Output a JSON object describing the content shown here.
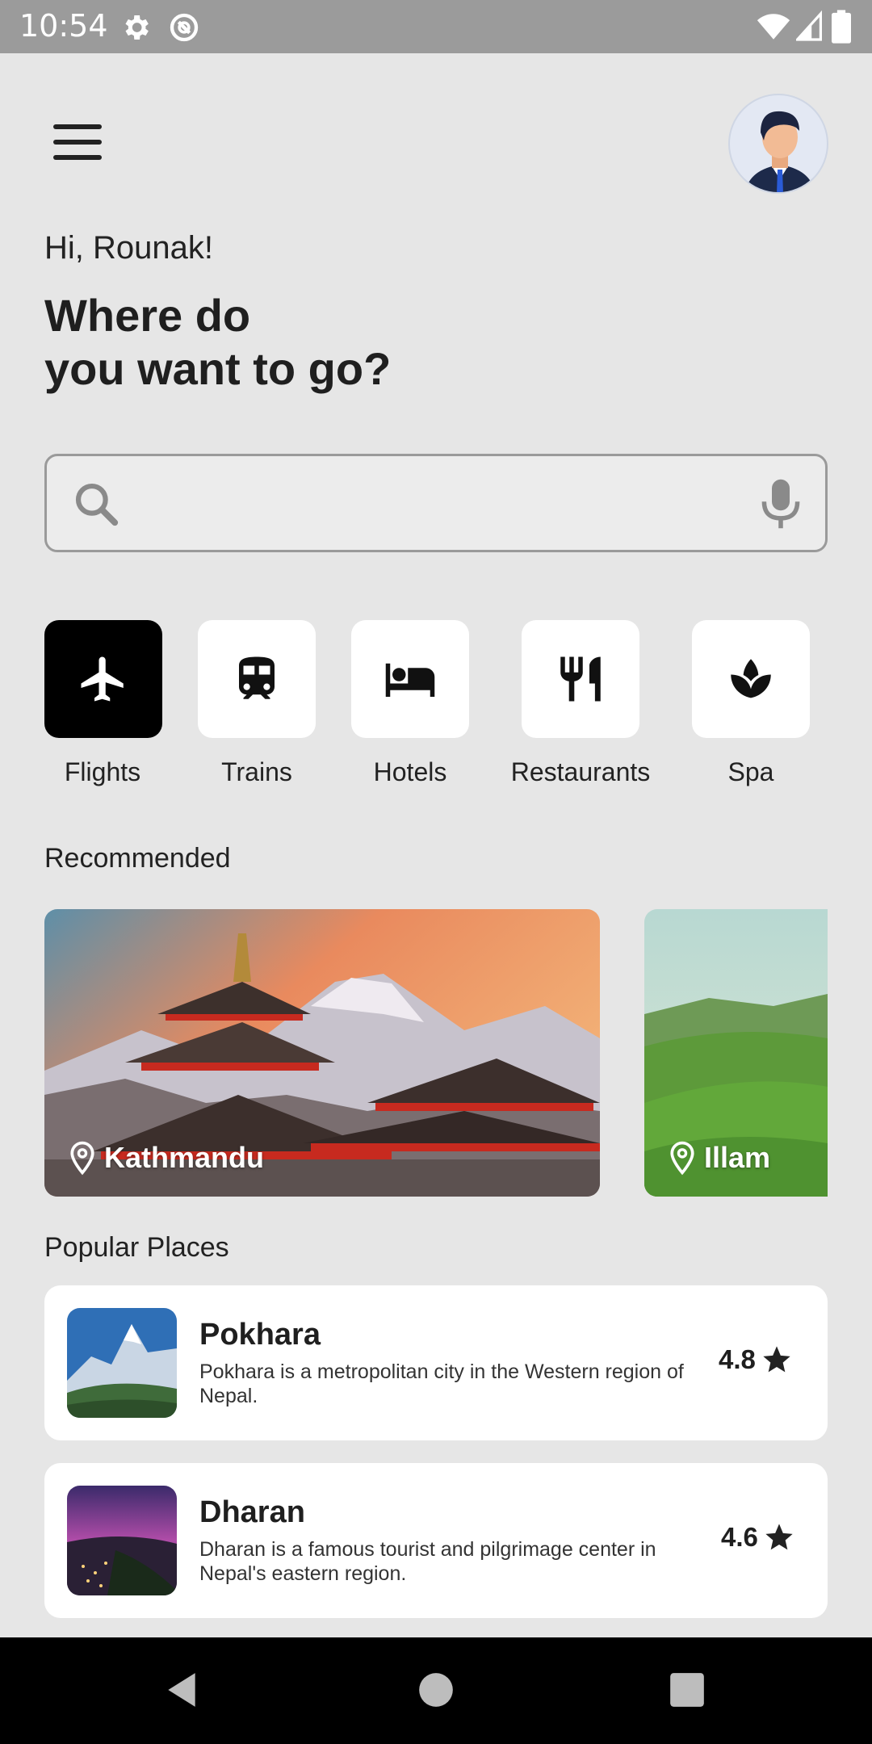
{
  "status_bar": {
    "time": "10:54"
  },
  "header": {
    "greeting": "Hi, Rounak!",
    "headline_line1": "Where do",
    "headline_line2": "you want to go?"
  },
  "search": {
    "placeholder": "",
    "value": ""
  },
  "categories": [
    {
      "label": "Flights",
      "icon": "airplane-icon",
      "active": true
    },
    {
      "label": "Trains",
      "icon": "train-icon",
      "active": false
    },
    {
      "label": "Hotels",
      "icon": "bed-icon",
      "active": false
    },
    {
      "label": "Restaurants",
      "icon": "fork-knife-icon",
      "active": false
    },
    {
      "label": "Spa",
      "icon": "spa-icon",
      "active": false
    }
  ],
  "recommended": {
    "title": "Recommended",
    "items": [
      {
        "name": "Kathmandu"
      },
      {
        "name": "Illam"
      }
    ]
  },
  "popular": {
    "title": "Popular Places",
    "items": [
      {
        "name": "Pokhara",
        "description": "Pokhara is a metropolitan city in the Western region of Nepal.",
        "rating": "4.8"
      },
      {
        "name": "Dharan",
        "description": "Dharan is a famous tourist and pilgrimage center in Nepal's eastern region.",
        "rating": "4.6"
      }
    ]
  },
  "colors": {
    "background": "#e6e6e6",
    "active_category": "#000000",
    "card": "#ffffff",
    "status_bar": "#9b9b9b"
  }
}
